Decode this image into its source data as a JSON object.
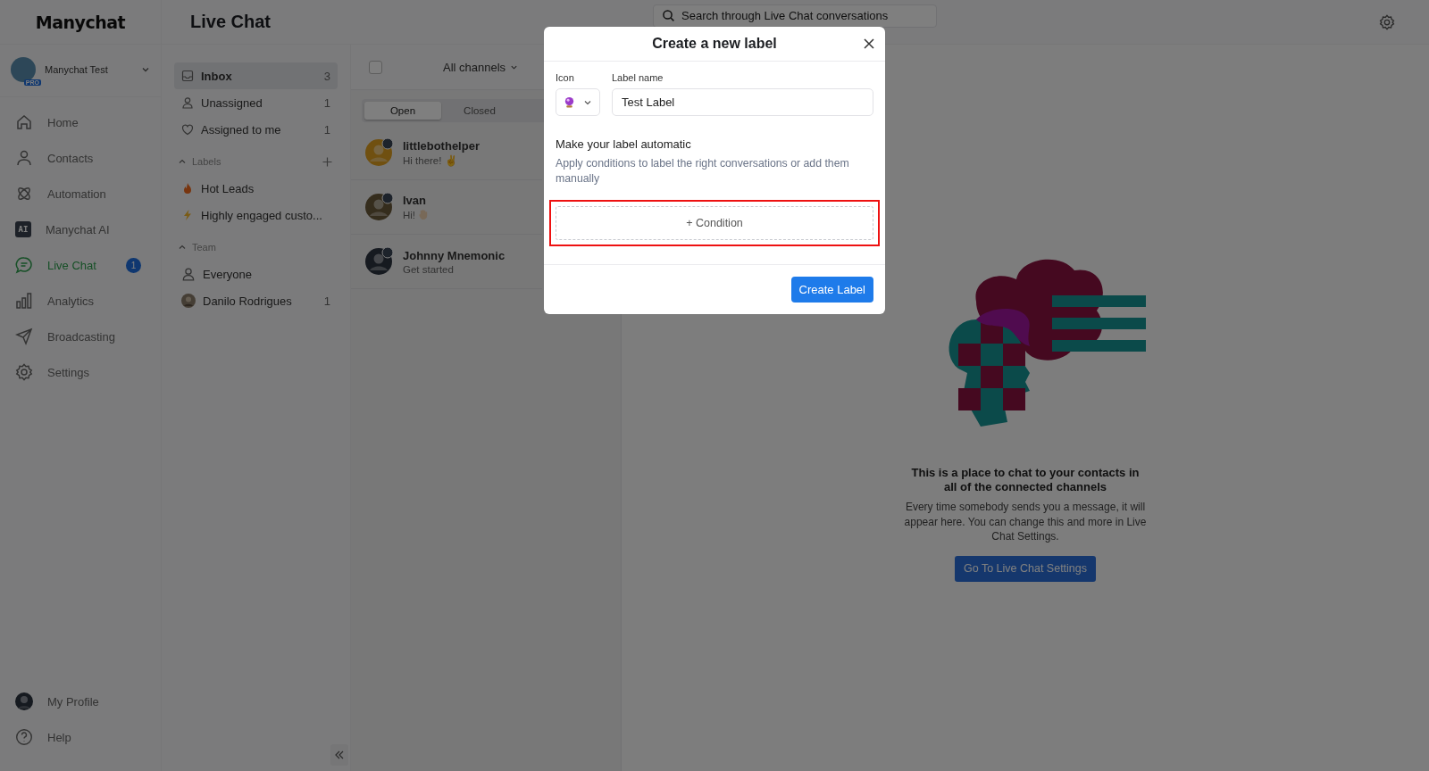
{
  "app": {
    "logo": "Manychat",
    "page_title": "Live Chat"
  },
  "account": {
    "name": "Manychat Test",
    "plan": "PRO"
  },
  "nav": [
    {
      "label": "Home",
      "kind": "home",
      "selected": false
    },
    {
      "label": "Contacts",
      "kind": "contacts",
      "selected": false
    },
    {
      "label": "Automation",
      "kind": "automation",
      "selected": false
    },
    {
      "label": "Manychat AI",
      "kind": "ai",
      "icon_text": "AI",
      "selected": false
    },
    {
      "label": "Live Chat",
      "kind": "chat",
      "selected": true,
      "badge": "1"
    },
    {
      "label": "Analytics",
      "kind": "analytics",
      "selected": false
    },
    {
      "label": "Broadcasting",
      "kind": "broadcast",
      "selected": false
    },
    {
      "label": "Settings",
      "kind": "settings",
      "selected": false
    }
  ],
  "nav_bottom": [
    {
      "label": "My Profile",
      "kind": "avatar"
    },
    {
      "label": "Help",
      "kind": "help"
    }
  ],
  "inbox_items": [
    {
      "label": "Inbox",
      "kind": "inbox",
      "count": "3",
      "selected": true
    },
    {
      "label": "Unassigned",
      "kind": "user",
      "count": "1",
      "selected": false
    },
    {
      "label": "Assigned to me",
      "kind": "heart",
      "count": "1",
      "selected": false
    }
  ],
  "labels_section": {
    "title": "Labels",
    "expanded": true,
    "items": [
      {
        "label": "Hot Leads",
        "kind": "fire"
      },
      {
        "label": "Highly engaged custo...",
        "kind": "bolt"
      }
    ]
  },
  "team_section": {
    "title": "Team",
    "expanded": true,
    "items": [
      {
        "label": "Everyone",
        "kind": "user"
      },
      {
        "label": "Danilo Rodrigues",
        "kind": "avatar",
        "count": "1"
      }
    ]
  },
  "search": {
    "placeholder": "Search through Live Chat conversations"
  },
  "conversation_list": {
    "select_all_checked": false,
    "channel_filter": "All channels",
    "tabs": [
      {
        "label": "Open",
        "selected": true
      },
      {
        "label": "Closed",
        "selected": false
      }
    ],
    "items": [
      {
        "name": "littlebothelper",
        "message": "Hi there! ✌",
        "waving_hand": false
      },
      {
        "name": "Ivan",
        "message": "Hi!",
        "waving_hand": true
      },
      {
        "name": "Johnny Mnemonic",
        "message": "Get started",
        "waving_hand": false
      }
    ]
  },
  "empty_state": {
    "heading": "This is a place to chat to your contacts in all of the connected channels",
    "body": "Every time somebody sends you a message, it will appear here. You can change this and more in Live Chat Settings.",
    "button": "Go To Live Chat Settings"
  },
  "modal": {
    "title": "Create a new label",
    "icon_label": "Icon",
    "name_label": "Label name",
    "name_value": "Test Label",
    "heading": "Make your label automatic",
    "description": "Apply conditions to label the right conversations or add them manually",
    "condition_button": "+ Condition",
    "condition_highlighted": true,
    "submit_button": "Create Label"
  }
}
